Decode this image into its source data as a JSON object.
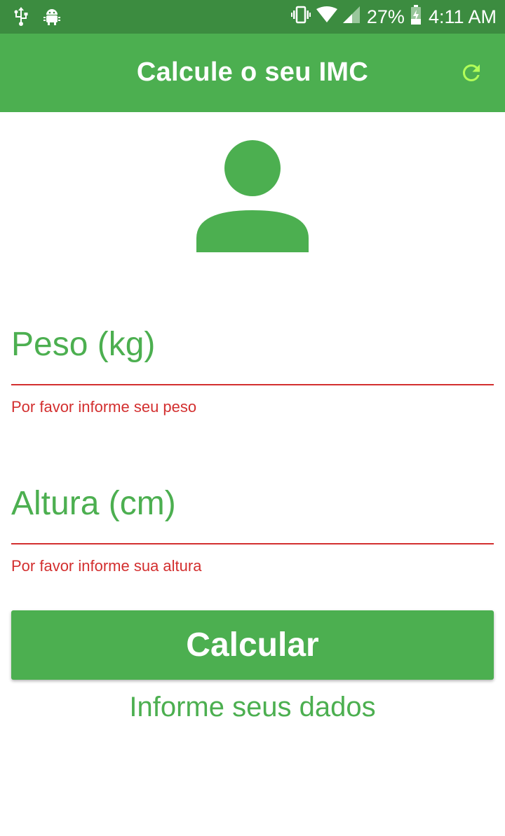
{
  "status_bar": {
    "battery_percent": "27%",
    "time": "4:11 AM",
    "icons": [
      "usb-icon",
      "android-debug-icon",
      "vibrate-icon",
      "wifi-icon",
      "cell-signal-icon",
      "battery-charging-icon"
    ]
  },
  "app_bar": {
    "title": "Calcule o seu IMC",
    "refresh_icon": "refresh-icon"
  },
  "avatar": {
    "icon": "person-icon"
  },
  "form": {
    "weight": {
      "label": "Peso (kg)",
      "value": "",
      "error": "Por favor informe seu peso"
    },
    "height": {
      "label": "Altura (cm)",
      "value": "",
      "error": "Por favor informe sua altura"
    }
  },
  "calculate_button": {
    "label": "Calcular"
  },
  "info": {
    "text": "Informe seus dados"
  },
  "colors": {
    "status_bar": "#3c8c40",
    "primary": "#4caf50",
    "error": "#d32f2f",
    "refresh_icon": "#b2ff59"
  }
}
